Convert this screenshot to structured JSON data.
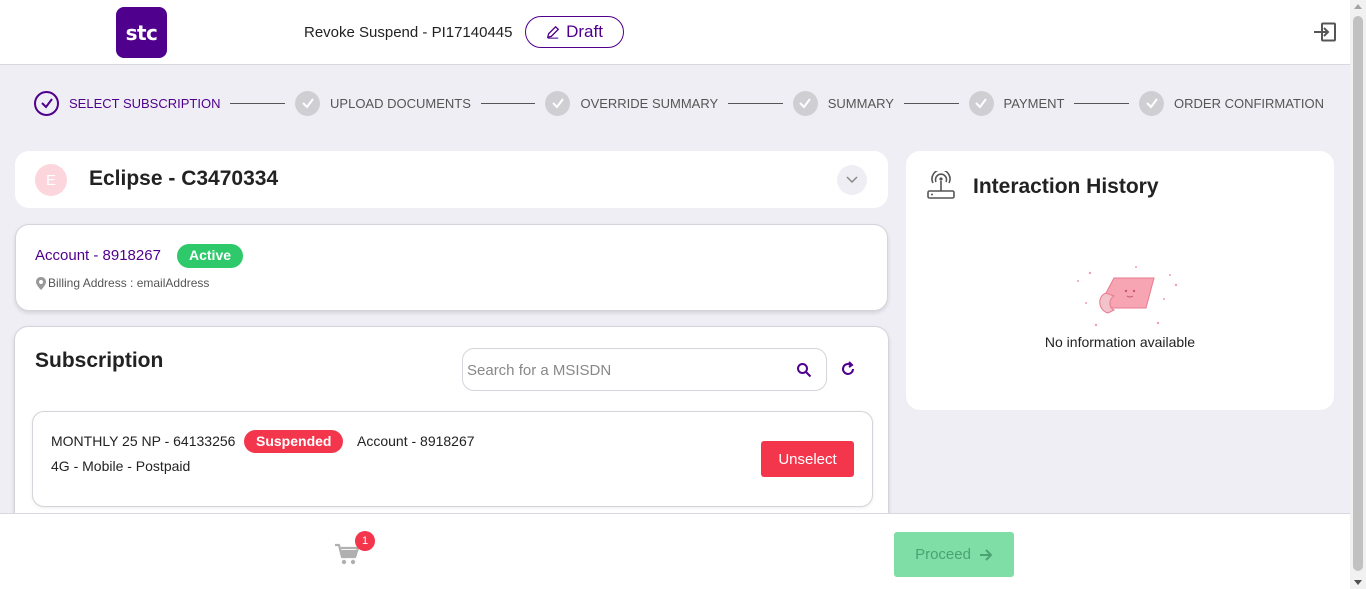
{
  "header": {
    "logo_text": "stc",
    "order_title": "Revoke Suspend - PI17140445",
    "draft_label": "Draft"
  },
  "stepper": {
    "steps": [
      {
        "label": "SELECT SUBSCRIPTION",
        "state": "active"
      },
      {
        "label": "UPLOAD DOCUMENTS",
        "state": "pending"
      },
      {
        "label": "OVERRIDE SUMMARY",
        "state": "pending"
      },
      {
        "label": "SUMMARY",
        "state": "pending"
      },
      {
        "label": "PAYMENT",
        "state": "pending"
      },
      {
        "label": "ORDER CONFIRMATION",
        "state": "pending"
      }
    ]
  },
  "customer": {
    "avatar_letter": "E",
    "name": "Eclipse - C3470334"
  },
  "account": {
    "title": "Account - 8918267",
    "status": "Active",
    "billing": "Billing Address : emailAddress"
  },
  "subscription": {
    "title": "Subscription",
    "search_placeholder": "Search for a MSISDN",
    "items": [
      {
        "plan": "MONTHLY 25 NP - 64133256",
        "status": "Suspended",
        "account": "Account - 8918267",
        "type": "4G - Mobile - Postpaid",
        "action_label": "Unselect"
      }
    ]
  },
  "history": {
    "title": "Interaction History",
    "empty_text": "No information available"
  },
  "footer": {
    "cart_count": "1",
    "proceed_label": "Proceed"
  },
  "colors": {
    "brand": "#4f008c",
    "active": "#2ec96b",
    "danger": "#f4364c",
    "proceed_disabled": "#7fdea6"
  }
}
